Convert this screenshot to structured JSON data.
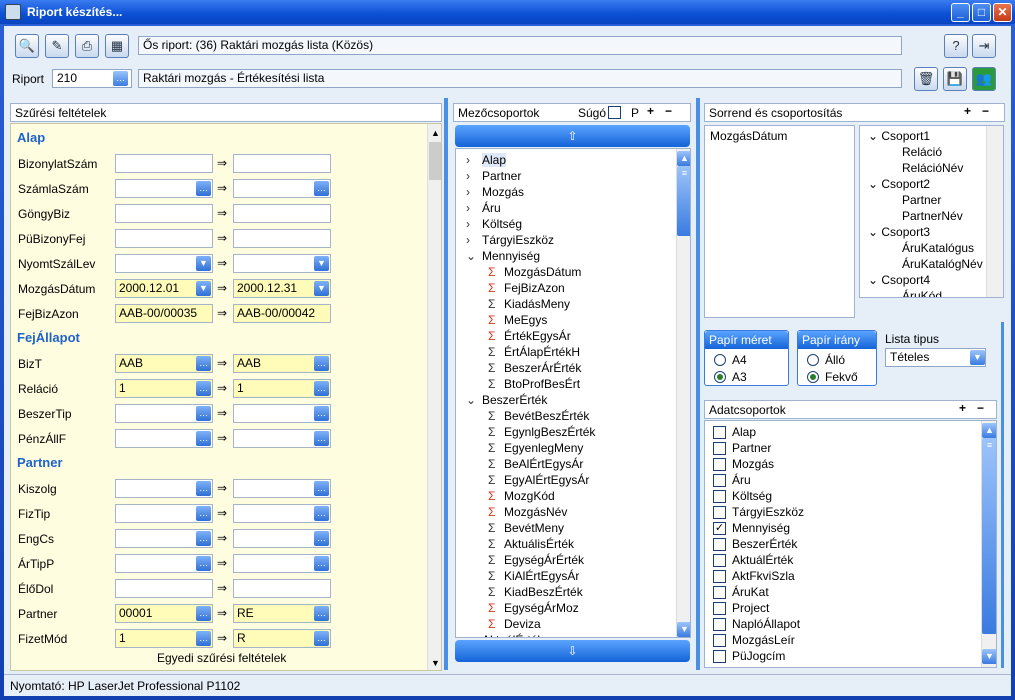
{
  "window": {
    "title": "Riport készítés..."
  },
  "toolbar": {
    "parent_report": "Ős riport: (36)  Raktári mozgás lista (Közös)",
    "report_label": "Riport",
    "report_number": "210",
    "report_name": "Raktári mozgás - Értékesítési lista"
  },
  "filter": {
    "header": "Szűrési feltételek",
    "footer": "Egyedi szűrési feltételek",
    "sections": {
      "alap": "Alap",
      "fejallapot": "FejÁllapot",
      "partner": "Partner"
    },
    "rows": [
      {
        "label": "BizonylatSzám",
        "from": "",
        "to": ""
      },
      {
        "label": "SzámlaSzám",
        "from": "",
        "to": ""
      },
      {
        "label": "GöngyBiz",
        "from": "",
        "to": ""
      },
      {
        "label": "PüBizonyFej",
        "from": "",
        "to": ""
      },
      {
        "label": "NyomtSzálLev",
        "from": "",
        "to": ""
      },
      {
        "label": "MozgásDátum",
        "from": "2000.12.01",
        "to": "2000.12.31"
      },
      {
        "label": "FejBizAzon",
        "from": "AAB-00/00035",
        "to": "AAB-00/00042"
      },
      {
        "label": "BizT",
        "from": "AAB",
        "to": "AAB"
      },
      {
        "label": "Reláció",
        "from": "1",
        "to": "1"
      },
      {
        "label": "BeszerTip",
        "from": "",
        "to": ""
      },
      {
        "label": "PénzÁllF",
        "from": "",
        "to": ""
      },
      {
        "label": "Kiszolg",
        "from": "",
        "to": ""
      },
      {
        "label": "FizTip",
        "from": "",
        "to": ""
      },
      {
        "label": "EngCs",
        "from": "",
        "to": ""
      },
      {
        "label": "ÁrTipP",
        "from": "",
        "to": ""
      },
      {
        "label": "ÉlőDol",
        "from": "",
        "to": ""
      },
      {
        "label": "Partner",
        "from": "00001",
        "to": "RE"
      },
      {
        "label": "FizetMód",
        "from": "1",
        "to": "R"
      }
    ]
  },
  "fields": {
    "header": "Mezőcsoportok",
    "help": "Súgó",
    "p": "P",
    "tree": [
      {
        "label": "Alap",
        "level": 0,
        "exp": "›"
      },
      {
        "label": "Partner",
        "level": 0,
        "exp": "›"
      },
      {
        "label": "Mozgás",
        "level": 0,
        "exp": "›"
      },
      {
        "label": "Áru",
        "level": 0,
        "exp": "›"
      },
      {
        "label": "Költség",
        "level": 0,
        "exp": "›"
      },
      {
        "label": "TárgyiEszköz",
        "level": 0,
        "exp": "›"
      },
      {
        "label": "Mennyiség",
        "level": 0,
        "exp": "⌄"
      },
      {
        "label": "MozgásDátum",
        "level": 1,
        "icon": "Σ",
        "red": true
      },
      {
        "label": "FejBizAzon",
        "level": 1,
        "icon": "Σ",
        "red": true
      },
      {
        "label": "KiadásMeny",
        "level": 1,
        "icon": "Σ"
      },
      {
        "label": "MeEgys",
        "level": 1,
        "icon": "Σ",
        "red": true
      },
      {
        "label": "ÉrtékEgysÁr",
        "level": 1,
        "icon": "Σ",
        "red": true
      },
      {
        "label": "ÉrtÁlapÉrtékH",
        "level": 1,
        "icon": "Σ"
      },
      {
        "label": "BeszerÁrÉrték",
        "level": 1,
        "icon": "Σ"
      },
      {
        "label": "BtoProfBesÉrt",
        "level": 1,
        "icon": "Σ"
      },
      {
        "label": "BeszerÉrték",
        "level": 0,
        "exp": "⌄"
      },
      {
        "label": "BevétBeszÉrték",
        "level": 1,
        "icon": "Σ"
      },
      {
        "label": "EgynlgBeszÉrték",
        "level": 1,
        "icon": "Σ"
      },
      {
        "label": "EgyenlegMeny",
        "level": 1,
        "icon": "Σ"
      },
      {
        "label": "BeAlÉrtEgysÁr",
        "level": 1,
        "icon": "Σ"
      },
      {
        "label": "EgyAlÉrtEgysÁr",
        "level": 1,
        "icon": "Σ"
      },
      {
        "label": "MozgKód",
        "level": 1,
        "icon": "Σ",
        "red": true
      },
      {
        "label": "MozgásNév",
        "level": 1,
        "icon": "Σ",
        "red": true
      },
      {
        "label": "BevétMeny",
        "level": 1,
        "icon": "Σ"
      },
      {
        "label": "AktuálisÉrték",
        "level": 1,
        "icon": "Σ"
      },
      {
        "label": "EgységÁrÉrték",
        "level": 1,
        "icon": "Σ"
      },
      {
        "label": "KiAlÉrtEgysÁr",
        "level": 1,
        "icon": "Σ"
      },
      {
        "label": "KiadBeszÉrték",
        "level": 1,
        "icon": "Σ"
      },
      {
        "label": "EgységÁrMoz",
        "level": 1,
        "icon": "Σ",
        "red": true
      },
      {
        "label": "Deviza",
        "level": 1,
        "icon": "Σ",
        "red": true
      },
      {
        "label": "AktuálÉrték",
        "level": 0,
        "exp": "⌄"
      }
    ]
  },
  "sort": {
    "header": "Sorrend és csoportosítás",
    "order": [
      "MozgásDátum"
    ],
    "groups": [
      {
        "label": "Csoport1",
        "level": 0
      },
      {
        "label": "Reláció",
        "level": 1
      },
      {
        "label": "RelációNév",
        "level": 1
      },
      {
        "label": "Csoport2",
        "level": 0
      },
      {
        "label": "Partner",
        "level": 1
      },
      {
        "label": "PartnerNév",
        "level": 1
      },
      {
        "label": "Csoport3",
        "level": 0
      },
      {
        "label": "ÁruKatalógus",
        "level": 1
      },
      {
        "label": "ÁruKatalógNév",
        "level": 1
      },
      {
        "label": "Csoport4",
        "level": 0
      },
      {
        "label": "ÁruKód",
        "level": 1
      }
    ]
  },
  "paper": {
    "size_title": "Papír méret",
    "size_a4": "A4",
    "size_a3": "A3",
    "dir_title": "Papír irány",
    "dir_allo": "Álló",
    "dir_fekvo": "Fekvő",
    "list_type_label": "Lista tipus",
    "list_type_value": "Tételes"
  },
  "datagroups": {
    "header": "Adatcsoportok",
    "items": [
      {
        "label": "Alap",
        "checked": false
      },
      {
        "label": "Partner",
        "checked": false
      },
      {
        "label": "Mozgás",
        "checked": false
      },
      {
        "label": "Áru",
        "checked": false
      },
      {
        "label": "Költség",
        "checked": false
      },
      {
        "label": "TárgyiEszköz",
        "checked": false
      },
      {
        "label": "Mennyiség",
        "checked": true
      },
      {
        "label": "BeszerÉrték",
        "checked": false
      },
      {
        "label": "AktuálÉrték",
        "checked": false
      },
      {
        "label": "AktFkviSzla",
        "checked": false
      },
      {
        "label": "ÁruKat",
        "checked": false
      },
      {
        "label": "Project",
        "checked": false
      },
      {
        "label": "NaplóÁllapot",
        "checked": false
      },
      {
        "label": "MozgásLeír",
        "checked": false
      },
      {
        "label": "PüJogcím",
        "checked": false
      }
    ]
  },
  "status": {
    "printer": "Nyomtató: HP LaserJet Professional P1102"
  }
}
